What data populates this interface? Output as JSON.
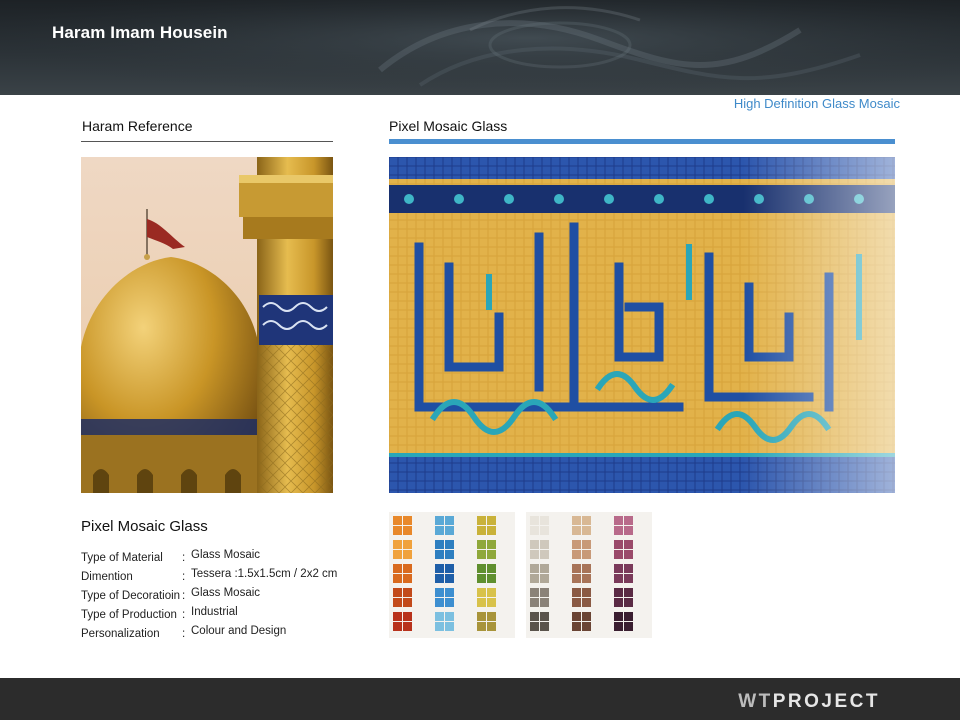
{
  "header": {
    "title": "Haram Imam Housein"
  },
  "tagline": "High Definition Glass Mosaic",
  "sections": {
    "reference_label": "Haram Reference",
    "mosaic_label": "Pixel Mosaic Glass"
  },
  "info": {
    "title": "Pixel Mosaic Glass",
    "specs": [
      {
        "key": "Type of Material",
        "value": "Glass Mosaic"
      },
      {
        "key": "Dimention",
        "value": "Tessera :1.5x1.5cm / 2x2 cm"
      },
      {
        "key": "Type of Decoratioin",
        "value": "Glass Mosaic"
      },
      {
        "key": "Type of Production",
        "value": "Industrial"
      },
      {
        "key": "Personalization",
        "value": "Colour and Design"
      }
    ],
    "separator": ":"
  },
  "footer": {
    "logo_a": "WT",
    "logo_b": "PROJECT"
  },
  "colors": {
    "accent": "#4a8fd0",
    "tagline": "#3f8ac9",
    "header_bg": "#2b3237",
    "footer_bg": "#2c2c2c",
    "gold": "#d9a63a",
    "turquoise": "#2aa6b8",
    "navy": "#1f3f8f"
  }
}
